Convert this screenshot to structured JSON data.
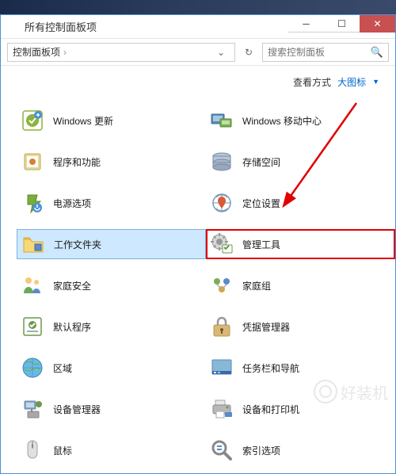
{
  "window": {
    "title": "所有控制面板项"
  },
  "breadcrumb": {
    "text": "控制面板项",
    "arrow": "›"
  },
  "search": {
    "placeholder": "搜索控制面板"
  },
  "viewbar": {
    "label": "查看方式",
    "value": "大图标"
  },
  "items": [
    {
      "name": "windows-update",
      "label": "Windows 更新",
      "icon": "update"
    },
    {
      "name": "mobility-center",
      "label": "Windows 移动中心",
      "icon": "mobility"
    },
    {
      "name": "programs-features",
      "label": "程序和功能",
      "icon": "programs"
    },
    {
      "name": "storage-spaces",
      "label": "存储空间",
      "icon": "storage"
    },
    {
      "name": "power-options",
      "label": "电源选项",
      "icon": "power"
    },
    {
      "name": "location-settings",
      "label": "定位设置",
      "icon": "location"
    },
    {
      "name": "work-folders",
      "label": "工作文件夹",
      "icon": "folder",
      "selected": true
    },
    {
      "name": "admin-tools",
      "label": "管理工具",
      "icon": "admin",
      "highlighted": true
    },
    {
      "name": "family-safety",
      "label": "家庭安全",
      "icon": "family"
    },
    {
      "name": "homegroup",
      "label": "家庭组",
      "icon": "homegroup"
    },
    {
      "name": "default-programs",
      "label": "默认程序",
      "icon": "default"
    },
    {
      "name": "credential-manager",
      "label": "凭据管理器",
      "icon": "credential"
    },
    {
      "name": "region",
      "label": "区域",
      "icon": "region"
    },
    {
      "name": "taskbar-navigation",
      "label": "任务栏和导航",
      "icon": "taskbar"
    },
    {
      "name": "device-manager",
      "label": "设备管理器",
      "icon": "devicemgr"
    },
    {
      "name": "devices-printers",
      "label": "设备和打印机",
      "icon": "printer"
    },
    {
      "name": "mouse",
      "label": "鼠标",
      "icon": "mouse"
    },
    {
      "name": "indexing-options",
      "label": "索引选项",
      "icon": "indexing"
    }
  ],
  "watermark": {
    "text": "好装机"
  }
}
